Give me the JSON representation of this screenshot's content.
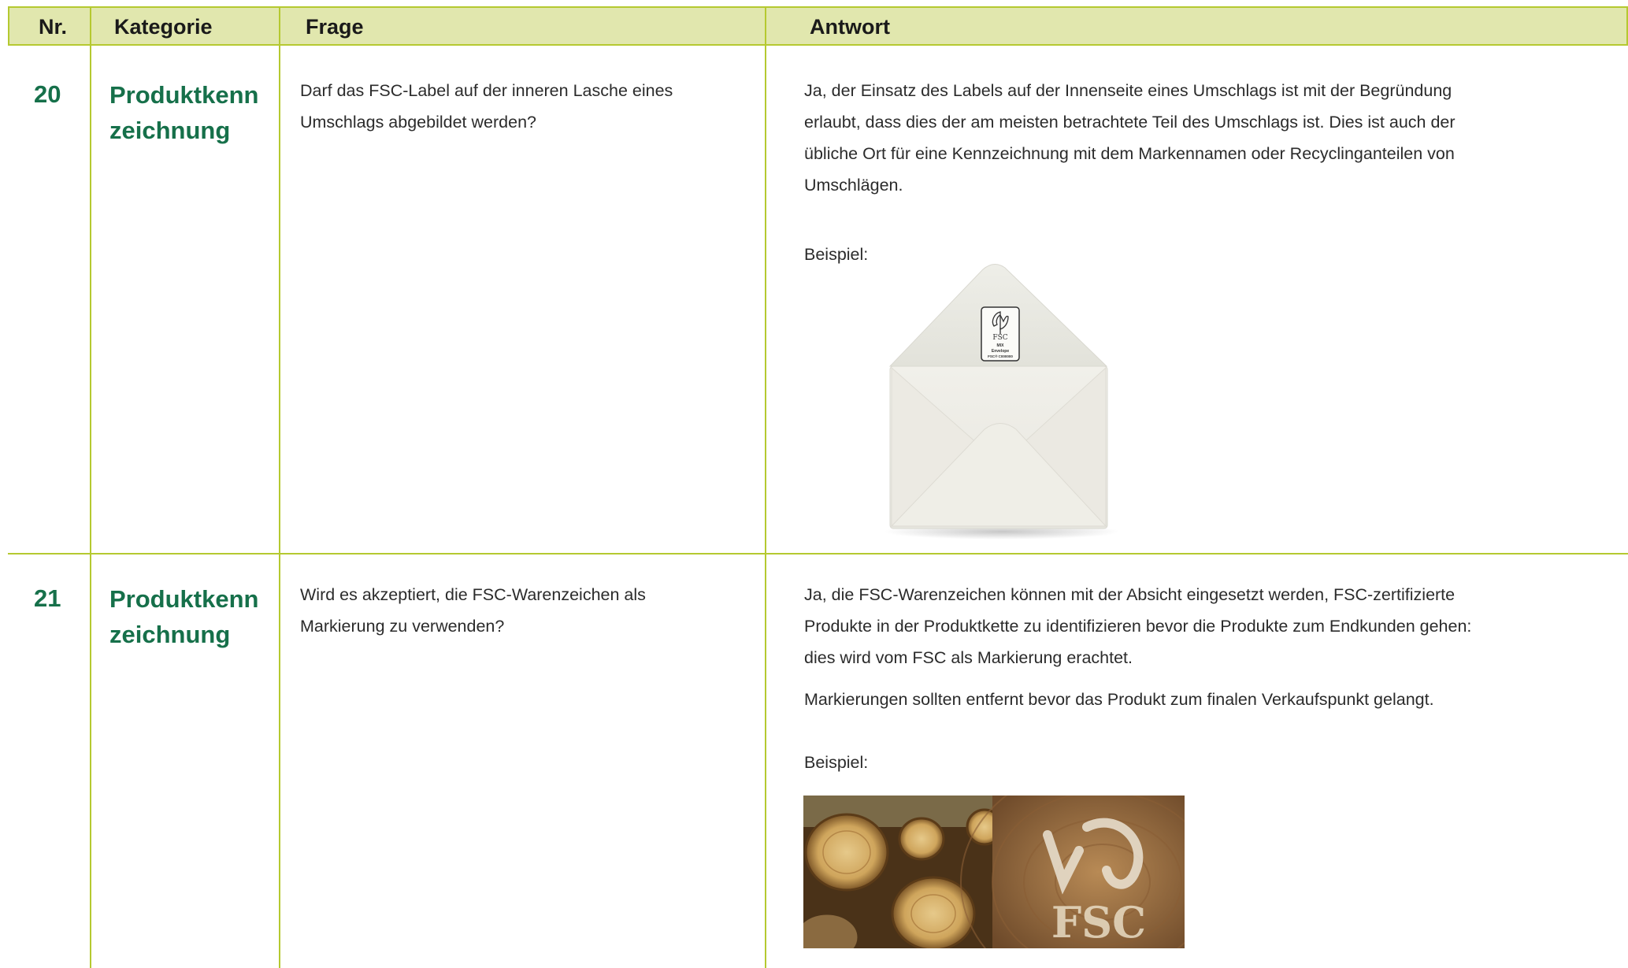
{
  "header": {
    "nr": "Nr.",
    "kategorie": "Kategorie",
    "frage": "Frage",
    "antwort": "Antwort"
  },
  "rows": [
    {
      "nr": "20",
      "kategorie_line1": "Produktkenn",
      "kategorie_line2": "zeichnung",
      "frage_line1": "Darf das FSC-Label auf der inneren Lasche eines",
      "frage_line2": "Umschlags abgebildet werden?",
      "antwort_lines": [
        "Ja, der Einsatz des Labels auf der Innenseite eines Umschlags ist mit der Begründung",
        "erlaubt, dass dies der am meisten betrachtete Teil des Umschlags ist. Dies ist auch der",
        "übliche Ort für eine Kennzeichnung mit dem Markennamen oder Recyclinganteilen von",
        "Umschlägen."
      ],
      "beispiel": "Beispiel:",
      "label_text": {
        "fsc": "FSC",
        "mix": "MIX",
        "product": "Envelope",
        "code": "FSC® C000000"
      }
    },
    {
      "nr": "21",
      "kategorie_line1": "Produktkenn",
      "kategorie_line2": "zeichnung",
      "frage_line1": "Wird es akzeptiert, die FSC-Warenzeichen als",
      "frage_line2": "Markierung zu verwenden?",
      "antwort_lines": [
        "Ja, die FSC-Warenzeichen können mit der Absicht eingesetzt werden, FSC-zertifizierte",
        "Produkte in der Produktkette zu identifizieren bevor die Produkte zum Endkunden gehen:",
        "dies wird vom FSC als Markierung erachtet."
      ],
      "antwort_extra": "Markierungen sollten entfernt bevor das Produkt zum finalen Verkaufspunkt gelangt.",
      "beispiel": "Beispiel:",
      "photo_text": "FSC"
    }
  ],
  "colors": {
    "accent_green": "#16704a",
    "rule_lime": "#b5c930",
    "header_bg": "#e1e7ae"
  }
}
